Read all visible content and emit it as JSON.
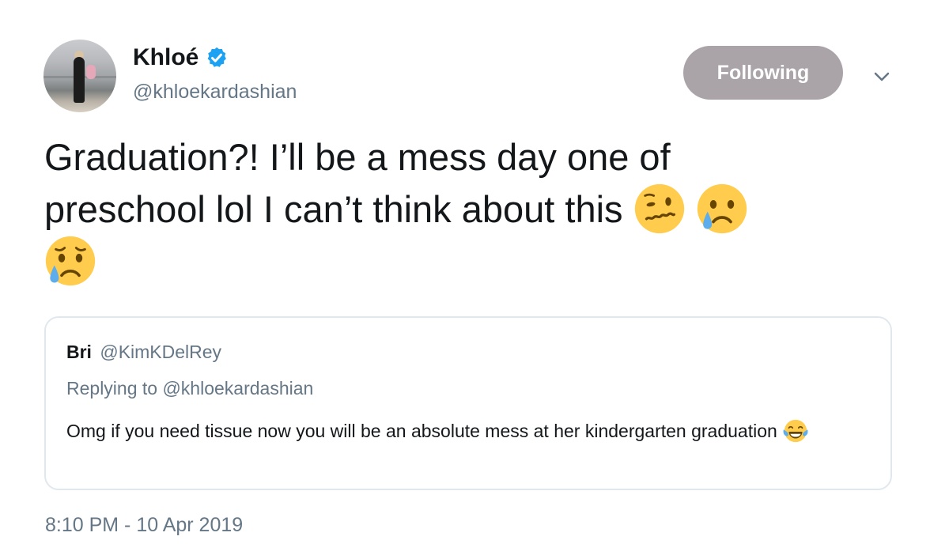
{
  "author": {
    "name": "Khloé",
    "handle": "@khloekardashian",
    "verified": true
  },
  "follow_button": {
    "label": "Following"
  },
  "tweet": {
    "line1": "Graduation?! I’ll be a mess day one of",
    "line2": "preschool lol I can’t think about this",
    "emojis": [
      "woozy-face",
      "crying-face",
      "sad-relieved-face"
    ]
  },
  "quoted_tweet": {
    "name": "Bri",
    "handle": "@KimKDelRey",
    "replying_to": "Replying to @khloekardashian",
    "text": "Omg if you need tissue now you will be an absolute mess at her kindergarten graduation",
    "emoji": "tears-of-joy-face"
  },
  "timestamp": "8:10 PM - 10 Apr 2019",
  "colors": {
    "text": "#14171a",
    "muted": "#657786",
    "verified_blue": "#1da1f2",
    "button_bg": "#aaa4a9",
    "border": "#e1e8ed",
    "emoji_yellow": "#ffcc4d",
    "tear_blue": "#5dadec"
  }
}
